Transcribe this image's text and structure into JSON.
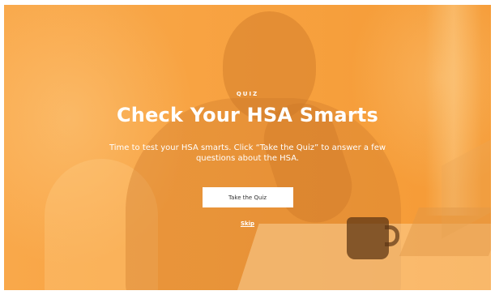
{
  "hero": {
    "eyebrow": "QUIZ",
    "title": "Check Your HSA Smarts",
    "description": "Time to test your HSA smarts. Click “Take the Quiz” to answer a few questions about the HSA.",
    "cta_label": "Take the Quiz",
    "skip_label": "Skip"
  },
  "colors": {
    "overlay_orange": "#f7a13f",
    "text": "#ffffff",
    "button_bg": "#ffffff",
    "button_text": "#333333"
  }
}
